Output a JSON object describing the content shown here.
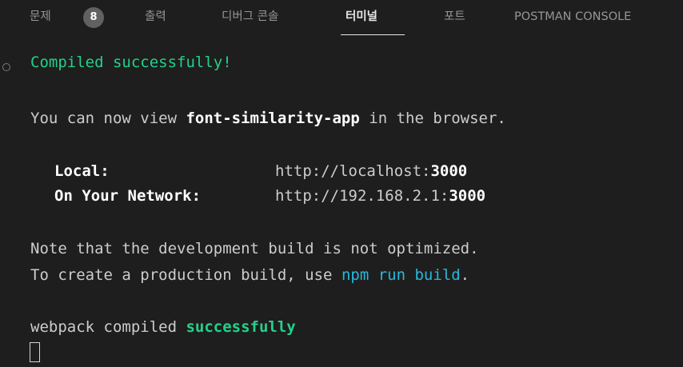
{
  "tabs": {
    "problems": "문제",
    "problems_count": "8",
    "output": "출력",
    "debug_console": "디버그 콘솔",
    "terminal": "터미널",
    "ports": "포트",
    "postman_console": "POSTMAN CONSOLE"
  },
  "terminal": {
    "compiled": "Compiled successfully!",
    "view_prefix": "You can now view ",
    "app_name": "font-similarity-app",
    "view_suffix": " in the browser.",
    "local_label": "Local:",
    "local_url_prefix": "http://localhost:",
    "local_port": "3000",
    "network_label": "On Your Network:",
    "network_url_prefix": "http://192.168.2.1:",
    "network_port": "3000",
    "note_line": "Note that the development build is not optimized.",
    "build_prefix": "To create a production build, use ",
    "build_cmd": "npm run build",
    "build_suffix": ".",
    "webpack_prefix": "webpack compiled ",
    "webpack_status": "successfully"
  },
  "colors": {
    "background": "#1e1e1e",
    "success_green": "#23d18b",
    "link_blue": "#29b8db",
    "text": "#cccccc"
  }
}
